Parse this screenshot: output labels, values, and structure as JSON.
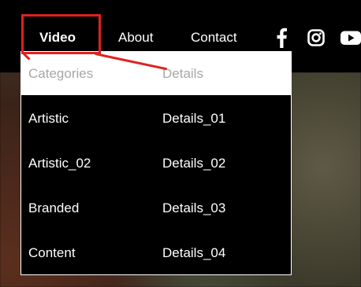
{
  "nav": {
    "video": "Video",
    "about": "About",
    "contact": "Contact"
  },
  "social": {
    "facebook_icon": "facebook-icon",
    "instagram_icon": "instagram-icon",
    "youtube_icon": "youtube-icon"
  },
  "dropdown": {
    "headers": {
      "categories": "Categories",
      "details": "Details"
    },
    "rows": [
      {
        "category": "Artistic",
        "details": "Details_01"
      },
      {
        "category": "Artistic_02",
        "details": "Details_02"
      },
      {
        "category": "Branded",
        "details": "Details_03"
      },
      {
        "category": "Content",
        "details": "Details_04"
      }
    ]
  },
  "colors": {
    "background": "#000000",
    "text": "#ffffff",
    "header_bg": "#ffffff",
    "header_text": "#a7a7a7",
    "annotation": "#e02020"
  }
}
